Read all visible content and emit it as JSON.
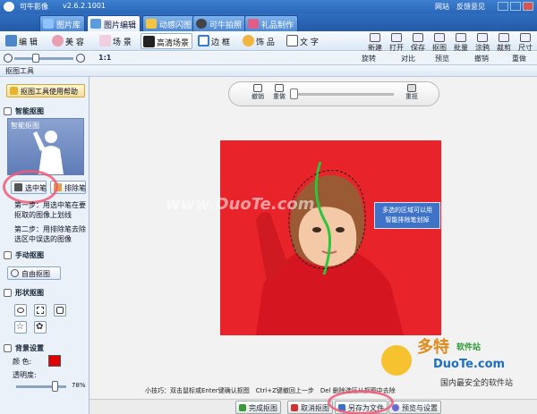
{
  "app": {
    "title": "可牛影像",
    "version": "v2.6.2.1001",
    "links": [
      "网站",
      "反馈意见"
    ]
  },
  "main_tabs": [
    {
      "label": "图片库",
      "active": false
    },
    {
      "label": "图片编辑",
      "active": true
    },
    {
      "label": "动感闪图",
      "active": false
    },
    {
      "label": "可牛拍照",
      "active": false
    },
    {
      "label": "礼品制作",
      "active": false
    }
  ],
  "sub_tabs": [
    {
      "label": "编 辑",
      "active": false
    },
    {
      "label": "美 容",
      "active": false
    },
    {
      "label": "场 景",
      "active": false
    },
    {
      "label": "高清场景",
      "active": false
    },
    {
      "label": "边 框",
      "active": false
    },
    {
      "label": "饰 品",
      "active": false
    },
    {
      "label": "文 字",
      "active": false
    }
  ],
  "toolbar": [
    "新建",
    "打开",
    "保存",
    "抠图",
    "批量",
    "涂鸦",
    "裁剪",
    "尺寸"
  ],
  "zoom": {
    "level_label": "1:1",
    "actions": [
      "旋转",
      "对比",
      "预览",
      "撤销",
      "重做"
    ]
  },
  "panel_title": "抠图工具",
  "help_button": "抠图工具使用帮助",
  "smart": {
    "title": "智能抠图",
    "thumb_caption": "智能抠图",
    "btn_select": "选中笔",
    "btn_remove": "排除笔",
    "step1": "第一步：用选中笔在要抠取的图像上划线",
    "step2": "第二步：用排除笔去除选区中误选的图像"
  },
  "manual": {
    "title": "手动抠图",
    "btn": "自由抠图"
  },
  "shape": {
    "title": "形状抠图"
  },
  "bg": {
    "title": "背景设置",
    "color_label": "颜 色:",
    "color": "#e00000",
    "opacity_label": "透明度:",
    "opacity_value": "78%"
  },
  "canvas_toolbar": {
    "undo": "撤销",
    "redo": "重做",
    "reset": "重抠"
  },
  "tooltip": {
    "line1": "多选的区域可以用",
    "line2": "智能排除笔划掉"
  },
  "watermark": "www.DuoTe.com",
  "logo": {
    "name": "多特",
    "sub": "软件站",
    "url": "DuoTe.com",
    "slogan": "国内最安全的软件站"
  },
  "tip_text": "小技巧：双击鼠标或Enter键确认抠图　Ctrl+Z键撤回上一步　Del 删除选区从抠图中去除",
  "bottom": {
    "done": "完成抠图",
    "cancel": "取消抠图",
    "saveas": "另存为文件",
    "preview": "预览与设置"
  },
  "colors": {
    "canvas_red": "#e8232a",
    "accent_blue": "#2b67b8",
    "highlight_ring": "#f05a78"
  }
}
